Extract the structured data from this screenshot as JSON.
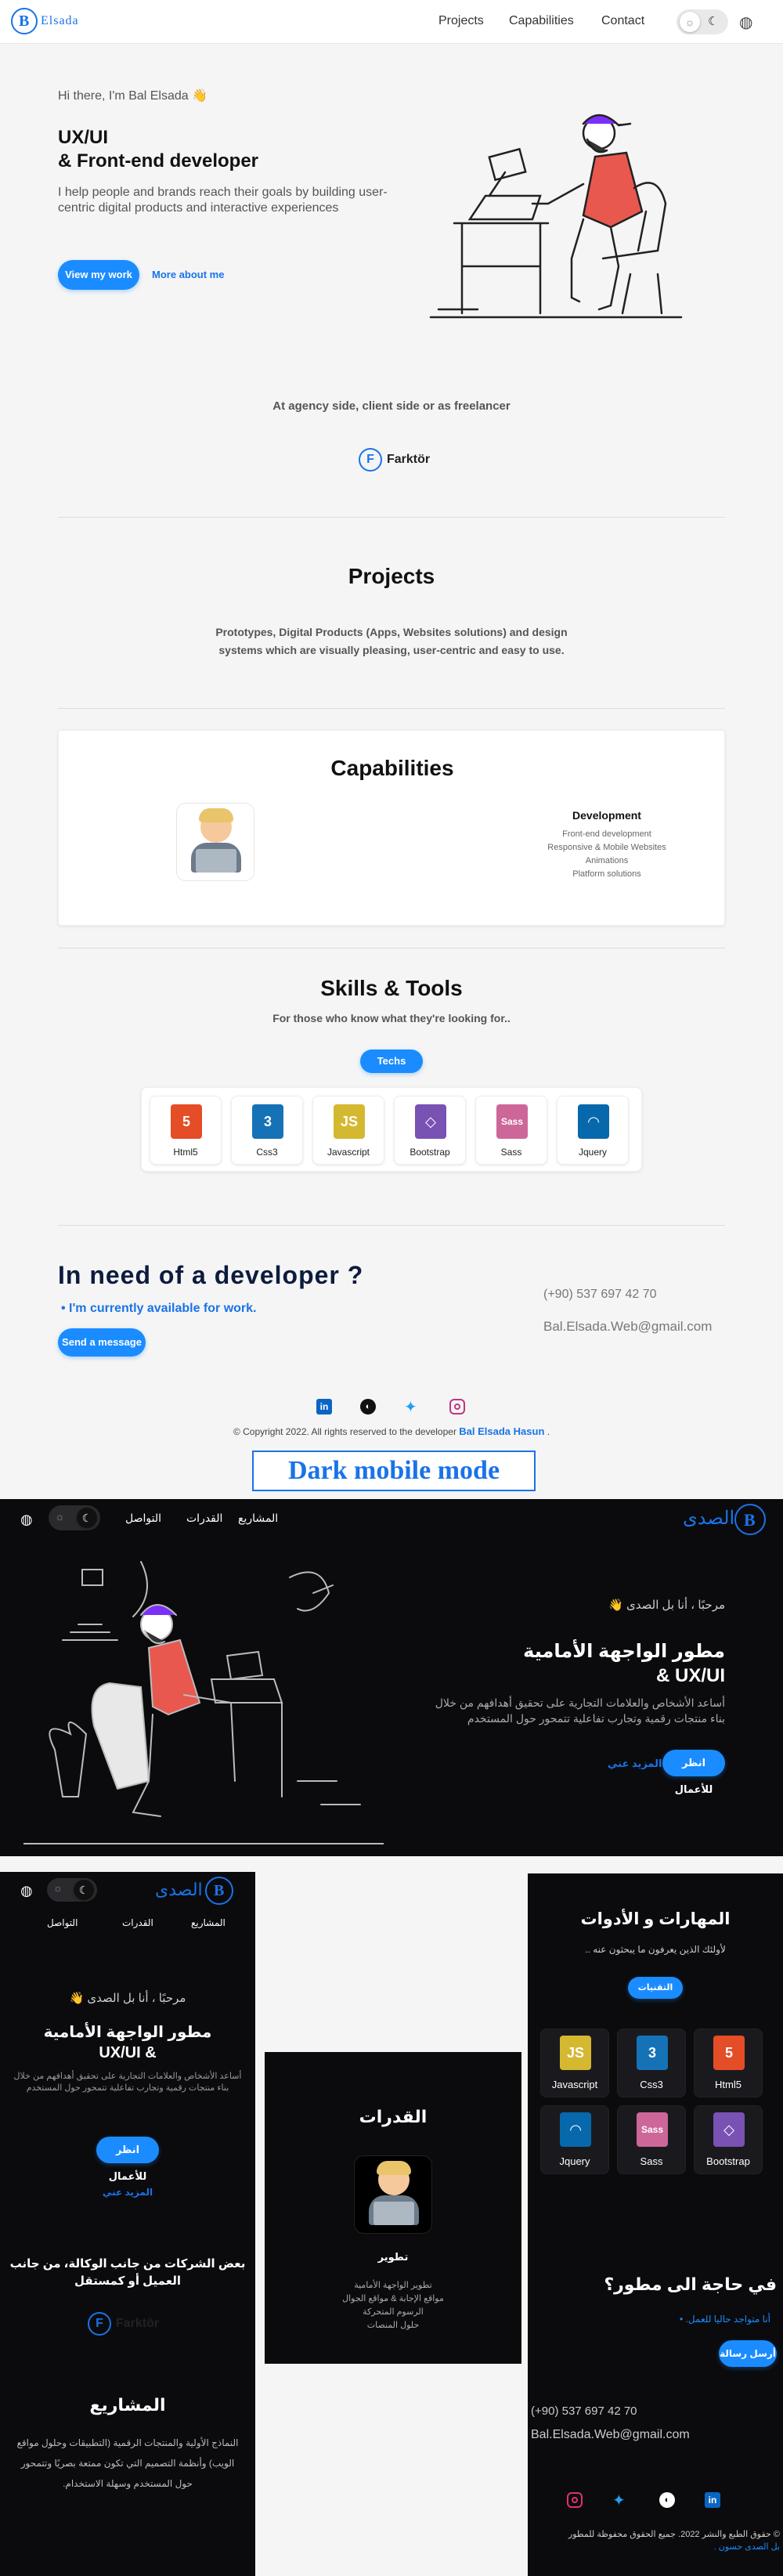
{
  "brand": "Elsada",
  "nav": {
    "projects": "Projects",
    "capabilities": "Capabilities",
    "contact": "Contact"
  },
  "hero": {
    "greeting": "Hi there, I'm Bal Elsada 👋",
    "title1": "UX/UI",
    "title2": "& Front-end developer",
    "desc": "I help people and brands reach their goals by building user-centric digital products and interactive experiences",
    "cta_primary": "View my work",
    "cta_secondary": "More about me"
  },
  "agency": {
    "heading": "At agency side, client side or as freelancer",
    "client": "Farktör"
  },
  "projects": {
    "heading": "Projects",
    "desc1": "Prototypes, Digital Products (Apps, Websites solutions) and design",
    "desc2": "systems which are visually pleasing, user-centric and easy to use."
  },
  "capabilities": {
    "heading": "Capabilities",
    "dev_title": "Development",
    "items": [
      "Front-end development",
      "Responsive & Mobile Websites",
      "Animations",
      "Platform solutions"
    ]
  },
  "skills": {
    "heading": "Skills & Tools",
    "sub": "For those who know what they're looking for..",
    "tab": "Techs",
    "tools": [
      {
        "name": "Html5",
        "color": "#e44d26",
        "icon": "html5-icon",
        "glyph": "5"
      },
      {
        "name": "Css3",
        "color": "#1572b6",
        "icon": "css3-icon",
        "glyph": "3"
      },
      {
        "name": "Javascript",
        "color": "#d4b830",
        "icon": "javascript-icon",
        "glyph": "JS"
      },
      {
        "name": "Bootstrap",
        "color": "#7952b3",
        "icon": "bootstrap-icon",
        "glyph": "◇"
      },
      {
        "name": "Sass",
        "color": "#cd6799",
        "icon": "sass-icon",
        "glyph": "Sass"
      },
      {
        "name": "Jquery",
        "color": "#0868ac",
        "icon": "jquery-icon",
        "glyph": "◠"
      }
    ]
  },
  "contact": {
    "heading": "In need of a developer ?",
    "available": "• I'm currently available for work.",
    "send": "Send a message",
    "phone": "(+90) 537 697 42 70",
    "email": "Bal.Elsada.Web@gmail.com"
  },
  "footer": {
    "copyright": "© Copyright 2022. All rights reserved to the developer",
    "author": "Bal Elsada Hasun",
    "dot": " ."
  },
  "dark_label": "Dark mobile mode",
  "ar": {
    "brand": "الصدى",
    "nav": [
      "المشاريع",
      "القدرات",
      "التواصل"
    ],
    "greeting": "مرحبًا ، أنا بل الصدى 👋",
    "title1": "مطور الواجهة الأمامية",
    "title2": "UX/UI &",
    "desc1": "أساعد الأشخاص والعلامات التجارية على تحقيق أهدافهم من خلال",
    "desc2": "بناء منتجات رقمية وتجارب تفاعلية تتمحور حول المستخدم",
    "cta_primary": "انظر للأعمال",
    "cta_secondary": "المزيد عني",
    "agency": "بعض الشركات من جانب الوكالة، من جانب العميل أو كمستقل",
    "projects": "المشاريع",
    "projects_desc": "النماذج الأولية والمنتجات الرقمية (التطبيقات وحلول مواقع الويب) وأنظمة التصميم التي تكون ممتعة بصريًا وتتمحور حول المستخدم وسهلة الاستخدام.",
    "capabilities": "القدرات",
    "dev": "تطوير",
    "cap_items": [
      "تطوير الواجهة الأمامية",
      "مواقع الإجابة & مواقع الجوال",
      "الرسوم المتحركة",
      "حلول المنصات"
    ],
    "skills": "المهارات و الأدوات",
    "skills_sub": "لأولئك الذين يعرفون ما يبحثون عنه ..",
    "tab": "التقنيات",
    "need": "في حاجة الى مطور؟",
    "available": "أنا متواجد حاليا للعمل.",
    "send": "أرسل رسالة",
    "copyright": "© حقوق الطبع والنشر 2022. جميع الحقوق محفوظة للمطور",
    "author": "بل الصدى حسون ."
  }
}
